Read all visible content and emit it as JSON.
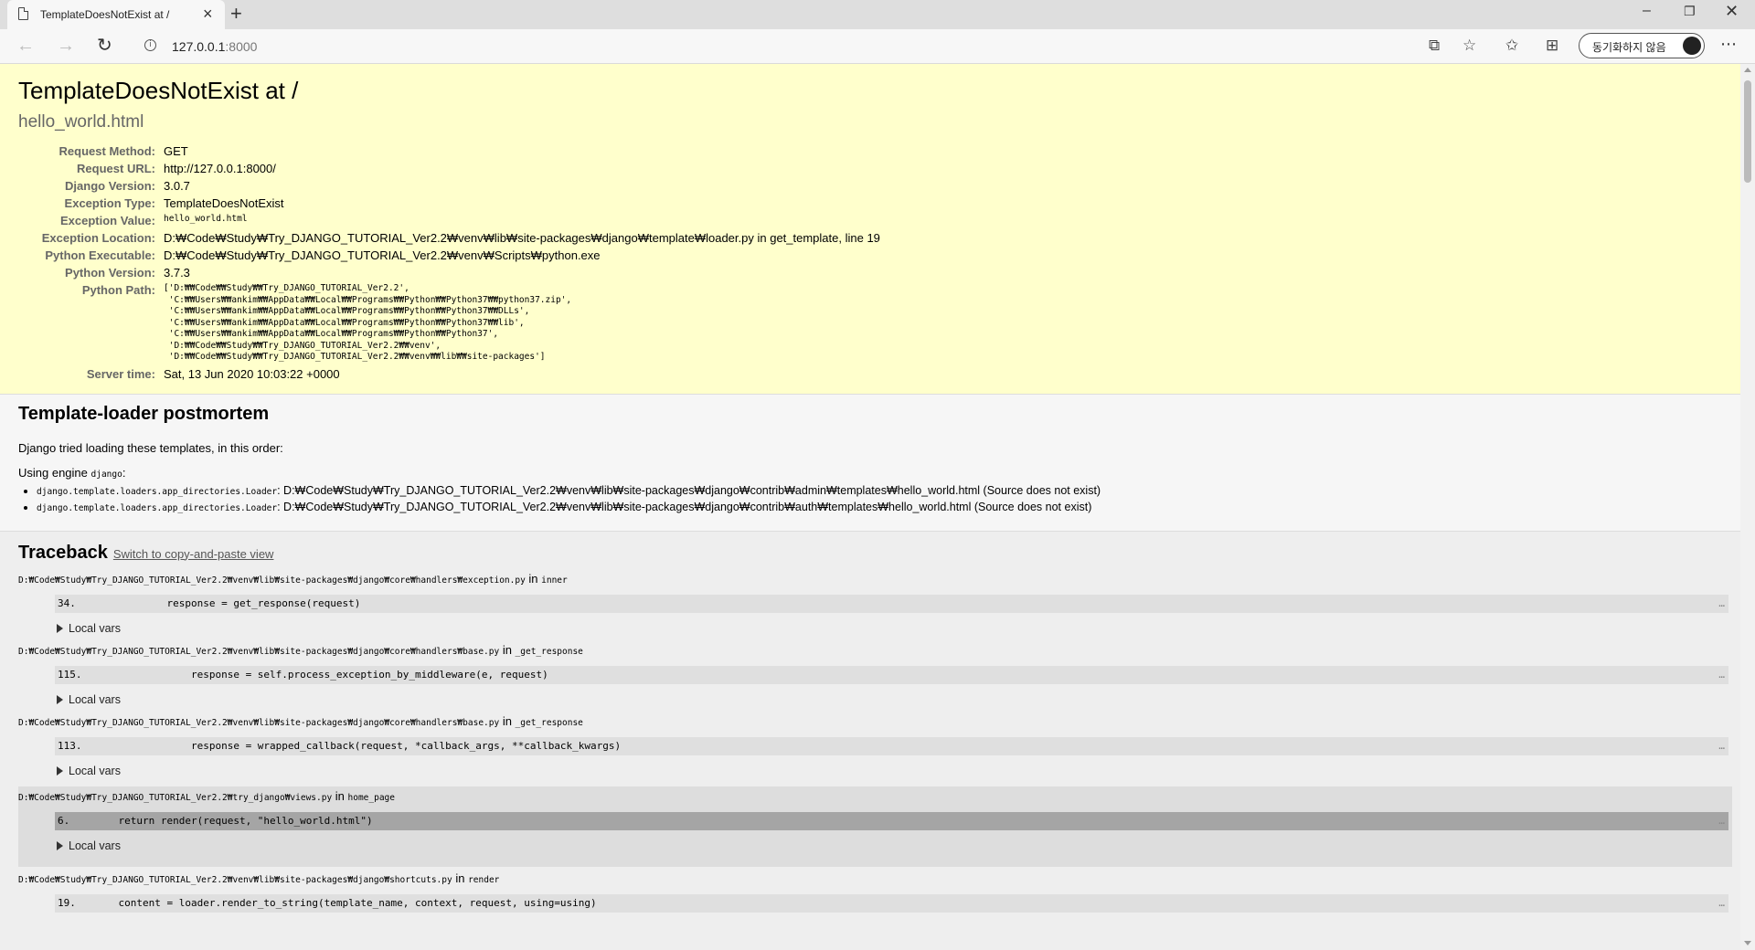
{
  "browser": {
    "tab_title": "TemplateDoesNotExist at /",
    "url_host": "127.0.0.1",
    "url_port": ":8000",
    "profile_label": "동기화하지 않음"
  },
  "summary": {
    "title": "TemplateDoesNotExist at /",
    "subtitle": "hello_world.html",
    "meta": [
      {
        "label": "Request Method:",
        "value": "GET"
      },
      {
        "label": "Request URL:",
        "value": "http://127.0.0.1:8000/"
      },
      {
        "label": "Django Version:",
        "value": "3.0.7"
      },
      {
        "label": "Exception Type:",
        "value": "TemplateDoesNotExist"
      },
      {
        "label": "Exception Value:",
        "value": "hello_world.html"
      },
      {
        "label": "Exception Location:",
        "value": "D:₩Code₩Study₩Try_DJANGO_TUTORIAL_Ver2.2₩venv₩lib₩site-packages₩django₩template₩loader.py in get_template, line 19"
      },
      {
        "label": "Python Executable:",
        "value": "D:₩Code₩Study₩Try_DJANGO_TUTORIAL_Ver2.2₩venv₩Scripts₩python.exe"
      },
      {
        "label": "Python Version:",
        "value": "3.7.3"
      },
      {
        "label": "Python Path:",
        "value": "['D:₩₩Code₩₩Study₩₩Try_DJANGO_TUTORIAL_Ver2.2',\n 'C:₩₩Users₩₩ankim₩₩AppData₩₩Local₩₩Programs₩₩Python₩₩Python37₩₩python37.zip',\n 'C:₩₩Users₩₩ankim₩₩AppData₩₩Local₩₩Programs₩₩Python₩₩Python37₩₩DLLs',\n 'C:₩₩Users₩₩ankim₩₩AppData₩₩Local₩₩Programs₩₩Python₩₩Python37₩₩lib',\n 'C:₩₩Users₩₩ankim₩₩AppData₩₩Local₩₩Programs₩₩Python₩₩Python37',\n 'D:₩₩Code₩₩Study₩₩Try_DJANGO_TUTORIAL_Ver2.2₩₩venv',\n 'D:₩₩Code₩₩Study₩₩Try_DJANGO_TUTORIAL_Ver2.2₩₩venv₩₩lib₩₩site-packages']"
      },
      {
        "label": "Server time:",
        "value": "Sat, 13 Jun 2020 10:03:22 +0000"
      }
    ]
  },
  "loader": {
    "heading": "Template-loader postmortem",
    "intro": "Django tried loading these templates, in this order:",
    "engine_prefix": "Using engine ",
    "engine_name": "django",
    "engine_suffix": ":",
    "items": [
      {
        "loader": "django.template.loaders.app_directories.Loader",
        "path": ": D:₩Code₩Study₩Try_DJANGO_TUTORIAL_Ver2.2₩venv₩lib₩site-packages₩django₩contrib₩admin₩templates₩hello_world.html (Source does not exist)"
      },
      {
        "loader": "django.template.loaders.app_directories.Loader",
        "path": ": D:₩Code₩Study₩Try_DJANGO_TUTORIAL_Ver2.2₩venv₩lib₩site-packages₩django₩contrib₩auth₩templates₩hello_world.html (Source does not exist)"
      }
    ]
  },
  "traceback": {
    "heading": "Traceback",
    "switch_link": "Switch to copy-and-paste view",
    "in_word": " in ",
    "local_vars_label": "Local vars",
    "ellipsis": "…",
    "frames": [
      {
        "file": "D:₩Code₩Study₩Try_DJANGO_TUTORIAL_Ver2.2₩venv₩lib₩site-packages₩django₩core₩handlers₩exception.py",
        "func": "inner",
        "lineno": "34.",
        "code": "            response = get_response(request)"
      },
      {
        "file": "D:₩Code₩Study₩Try_DJANGO_TUTORIAL_Ver2.2₩venv₩lib₩site-packages₩django₩core₩handlers₩base.py",
        "func": "_get_response",
        "lineno": "115.",
        "code": "                response = self.process_exception_by_middleware(e, request)"
      },
      {
        "file": "D:₩Code₩Study₩Try_DJANGO_TUTORIAL_Ver2.2₩venv₩lib₩site-packages₩django₩core₩handlers₩base.py",
        "func": "_get_response",
        "lineno": "113.",
        "code": "                response = wrapped_callback(request, *callback_args, **callback_kwargs)"
      },
      {
        "file": "D:₩Code₩Study₩Try_DJANGO_TUTORIAL_Ver2.2₩try_django₩views.py",
        "func": "home_page",
        "lineno": "6.",
        "code": "    return render(request, \"hello_world.html\")"
      },
      {
        "file": "D:₩Code₩Study₩Try_DJANGO_TUTORIAL_Ver2.2₩venv₩lib₩site-packages₩django₩shortcuts.py",
        "func": "render",
        "lineno": "19.",
        "code": "    content = loader.render_to_string(template_name, context, request, using=using)"
      }
    ]
  }
}
